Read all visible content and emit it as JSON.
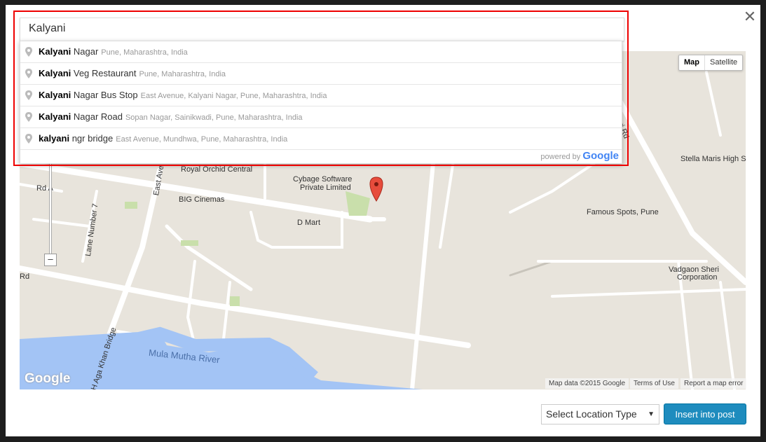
{
  "search": {
    "value": "Kalyani"
  },
  "suggestions": [
    {
      "match": "Kalyani",
      "rest": " Nagar",
      "secondary": "Pune, Maharashtra, India"
    },
    {
      "match": "Kalyani",
      "rest": " Veg Restaurant",
      "secondary": "Pune, Maharashtra, India"
    },
    {
      "match": "Kalyani",
      "rest": " Nagar Bus Stop",
      "secondary": "East Avenue, Kalyani Nagar, Pune, Maharashtra, India"
    },
    {
      "match": "Kalyani",
      "rest": " Nagar Road",
      "secondary": "Sopan Nagar, Sainikwadi, Pune, Maharashtra, India"
    },
    {
      "match": "kalyani",
      "rest": " ngr bridge",
      "secondary": "East Avenue, Mundhwa, Pune, Maharashtra, India"
    }
  ],
  "powered_by": "powered by",
  "powered_brand": "Google",
  "map_type": {
    "map": "Map",
    "satellite": "Satellite"
  },
  "map_labels": {
    "royal_orchid": "Royal Orchid Central",
    "cybage": "Cybage Software",
    "cybage2": "Private Limited",
    "big_cinemas": "BIG Cinemas",
    "dmart": "D Mart",
    "east_ave": "East Ave",
    "lane7": "Lane Number 7",
    "rd_a": "Rd A",
    "rd": "Rd",
    "river": "Mula Mutha River",
    "bridge": "H Aga Khan Bridge",
    "stella": "Stella Maris High S",
    "famous": "Famous Spots, Pune",
    "vadgaon": "Vadgaon Sheri",
    "vadgaon2": "Corporation",
    "sheri_rd": "n Sheri Rd",
    "logo": "Google"
  },
  "attribution": {
    "data": "Map data ©2015 Google",
    "terms": "Terms of Use",
    "report": "Report a map error"
  },
  "zoom": {
    "minus": "–"
  },
  "close": "✕",
  "location_select": {
    "selected": "Select Location Type"
  },
  "insert_button": "Insert into post"
}
